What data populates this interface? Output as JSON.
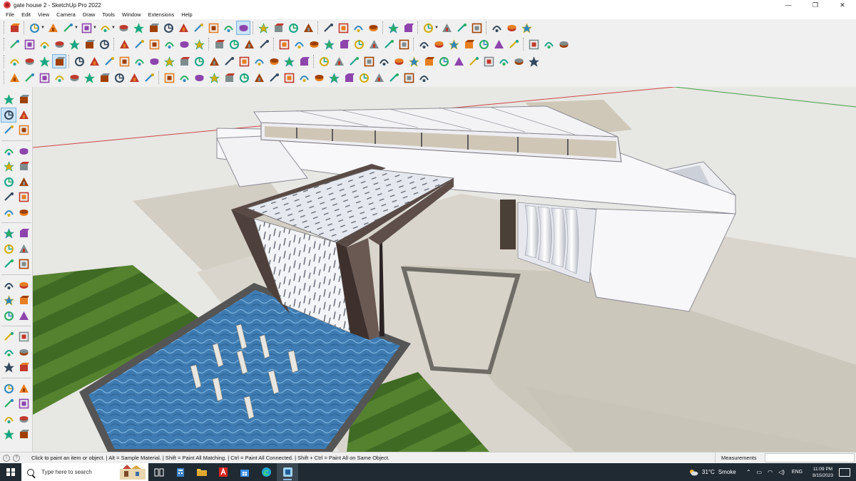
{
  "window": {
    "title": "gate house 2 - SketchUp Pro 2022",
    "minimize": "—",
    "restore": "❐",
    "close": "✕"
  },
  "menu": [
    "File",
    "Edit",
    "View",
    "Camera",
    "Draw",
    "Tools",
    "Window",
    "Extensions",
    "Help"
  ],
  "toolbars": {
    "row1": [
      "zoom-extents-icon",
      "select-icon",
      "eraser-icon",
      "line-icon",
      "arc-icon",
      "rectangle-icon",
      "push-pull-icon",
      "follow-me-icon",
      "move-icon",
      "rotate-icon",
      "scale-icon",
      "offset-icon",
      "tape-measure-icon",
      "text-icon",
      "paint-bucket-icon",
      "orbit-icon",
      "pan-icon",
      "zoom-icon",
      "zoom-window-icon",
      "components-icon",
      "layers-icon",
      "materials-icon",
      "styles-icon",
      "scenes-icon",
      "shadows-icon",
      "section-plane-icon",
      "sandbox-icon",
      "solid-tools-icon",
      "warehouse-icon",
      "extension-icon",
      "outliner-icon",
      "entity-info-icon"
    ],
    "row2": [
      "iso-view-icon",
      "top-view-icon",
      "front-view-icon",
      "right-view-icon",
      "back-view-icon",
      "left-view-icon",
      "bottom-view-icon",
      "xray-icon",
      "wireframe-icon",
      "hidden-line-icon",
      "shaded-icon",
      "textured-icon",
      "monochrome-icon",
      "camera-position-icon",
      "walk-icon",
      "look-around-icon",
      "position-camera-icon",
      "circle-icon",
      "polygon-icon",
      "freehand-icon",
      "pie-icon",
      "protractor-icon",
      "axes-icon",
      "dimension-icon",
      "3d-text-icon",
      "flip-icon",
      "soften-icon",
      "intersect-icon",
      "outer-shell-icon",
      "union-icon",
      "subtract-icon",
      "trim-icon",
      "split-icon",
      "paint-icon",
      "sample-icon",
      "match-photo-icon"
    ],
    "row3": [
      "box-icon",
      "plane-icon",
      "house-icon",
      "component-icon",
      "group-icon",
      "cube-icon",
      "sphere-icon",
      "cylinder-icon",
      "cone-icon",
      "torus-icon",
      "prism-icon",
      "pyramid-icon",
      "dome-icon",
      "arrow-icon",
      "cross-icon",
      "grid-icon",
      "ruler-icon",
      "triangle-icon",
      "lock-icon",
      "unlock-icon",
      "gear-icon",
      "home-icon",
      "refresh-icon",
      "magnet-icon",
      "link-icon",
      "brush-icon",
      "bucket-icon",
      "spline-icon",
      "bezier-icon",
      "curve-icon",
      "round-corner-icon",
      "chamfer-icon",
      "fillet-icon",
      "taper-icon",
      "stretch-icon"
    ],
    "row4": [
      "weld-icon",
      "explode-icon",
      "divide-icon",
      "extrude-icon",
      "loft-icon",
      "skin-icon",
      "sweep-icon",
      "shell-icon",
      "bend-icon",
      "twist-icon",
      "shear-icon",
      "morph-icon",
      "smooth-icon",
      "subdivide-icon",
      "crease-icon",
      "knife-icon",
      "slice-icon",
      "mirror-icon",
      "array-icon",
      "align-icon",
      "distribute-icon",
      "stack-icon",
      "join-icon",
      "cleanup-icon",
      "purge-icon",
      "report-icon",
      "export-icon",
      "import-icon"
    ]
  },
  "status": {
    "message": "Click to paint an item or object. | Alt = Sample Material. | Shift = Paint All Matching. | Ctrl = Paint All Connected. | Shift + Ctrl = Paint All on Same Object.",
    "measurements_label": "Measurements",
    "measurements_value": ""
  },
  "taskbar": {
    "search_placeholder": "Type here to search",
    "apps": [
      "task-view-icon",
      "file-explorer-icon",
      "folder-icon",
      "acrobat-icon",
      "store-icon",
      "edge-icon",
      "sketchup-icon"
    ],
    "weather_temp": "31°C",
    "weather_desc": "Smoke",
    "lang": "ENG",
    "time": "11:09 PM",
    "date": "8/15/2023"
  },
  "colors": {
    "sky": "#e7e7e3",
    "ground": "#cfcbc2",
    "building": "#f7f7f9",
    "water": "#3f7fb5",
    "grass": "#4e7a2f",
    "frame": "#5a4a46",
    "taskbar": "#1f2a33"
  }
}
